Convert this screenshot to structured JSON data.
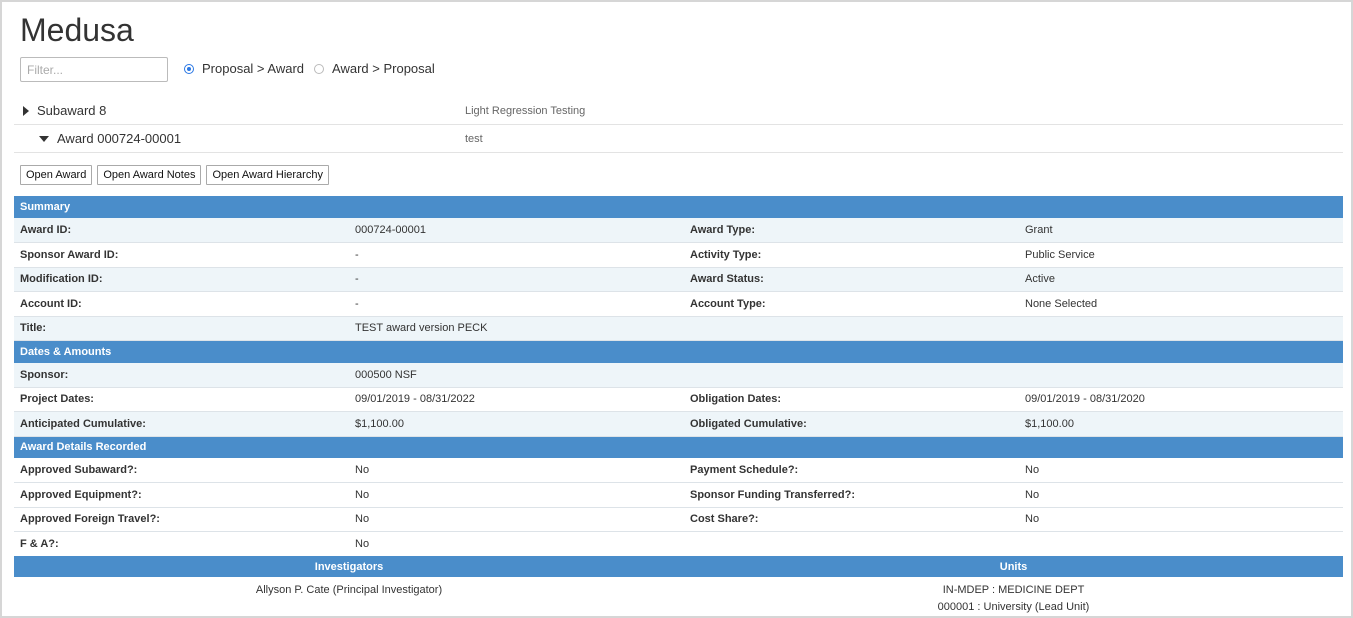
{
  "app": {
    "title": "Medusa"
  },
  "filter": {
    "placeholder": "Filter..."
  },
  "view_modes": [
    {
      "label": "Proposal > Award",
      "checked": true
    },
    {
      "label": "Award > Proposal",
      "checked": false
    }
  ],
  "tree": [
    {
      "name": "Subaward 8",
      "description": "Light Regression Testing",
      "expanded": false
    },
    {
      "name": "Award 000724-00001",
      "description": "test",
      "expanded": true
    }
  ],
  "buttons": {
    "open_award": "Open Award",
    "open_award_notes": "Open Award Notes",
    "open_award_hierarchy": "Open Award Hierarchy"
  },
  "summary": {
    "heading": "Summary",
    "rows": [
      [
        "Award ID:",
        "000724-00001",
        "Award Type:",
        "Grant"
      ],
      [
        "Sponsor Award ID:",
        "-",
        "Activity Type:",
        "Public Service"
      ],
      [
        "Modification ID:",
        "-",
        "Award Status:",
        "Active"
      ],
      [
        "Account ID:",
        "-",
        "Account Type:",
        "None Selected"
      ],
      [
        "Title:",
        "TEST award version PECK",
        "",
        ""
      ]
    ]
  },
  "dates_amounts": {
    "heading": "Dates & Amounts",
    "rows": [
      [
        "Sponsor:",
        "000500 NSF",
        "",
        ""
      ],
      [
        "Project Dates:",
        "09/01/2019 - 08/31/2022",
        "Obligation Dates:",
        "09/01/2019 - 08/31/2020"
      ],
      [
        "Anticipated Cumulative:",
        "$1,100.00",
        "Obligated Cumulative:",
        "$1,100.00"
      ]
    ]
  },
  "award_details": {
    "heading": "Award Details Recorded",
    "rows": [
      [
        "Approved Subaward?:",
        "No",
        "Payment Schedule?:",
        "No"
      ],
      [
        "Approved Equipment?:",
        "No",
        "Sponsor Funding Transferred?:",
        "No"
      ],
      [
        "Approved Foreign Travel?:",
        "No",
        "Cost Share?:",
        "No"
      ],
      [
        "F & A?:",
        "No",
        "",
        ""
      ]
    ]
  },
  "people": {
    "investigators_heading": "Investigators",
    "units_heading": "Units",
    "investigators": [
      "Allyson P. Cate (Principal Investigator)"
    ],
    "units": [
      "IN-MDEP : MEDICINE DEPT",
      "000001 : University (Lead Unit)"
    ]
  }
}
